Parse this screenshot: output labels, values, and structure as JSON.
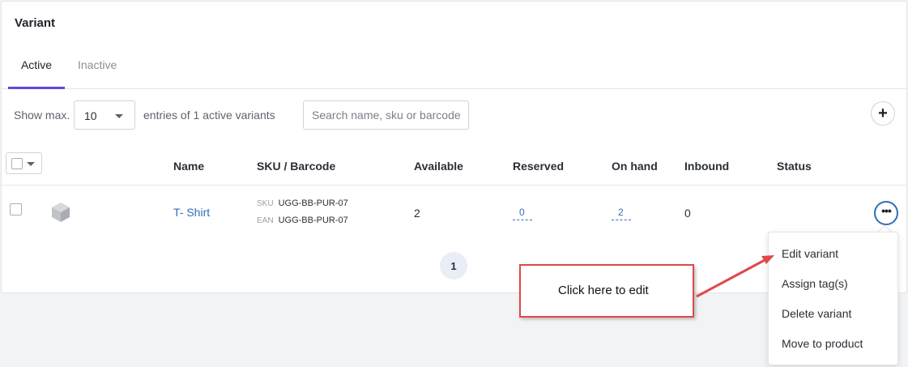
{
  "card": {
    "title": "Variant"
  },
  "tabs": [
    {
      "label": "Active",
      "active": true
    },
    {
      "label": "Inactive",
      "active": false
    }
  ],
  "toolbar": {
    "show_max_label": "Show max.",
    "entries_value": "10",
    "entries_suffix": "entries of 1 active variants",
    "search_placeholder": "Search name, sku or barcode",
    "add_icon": "plus-icon"
  },
  "table": {
    "columns": [
      "Name",
      "SKU / Barcode",
      "Available",
      "Reserved",
      "On hand",
      "Inbound",
      "Status"
    ],
    "rows": [
      {
        "name": "T- Shirt",
        "sku_tag": "SKU",
        "sku": "UGG-BB-PUR-07",
        "ean_tag": "EAN",
        "ean": "UGG-BB-PUR-07",
        "available": "2",
        "reserved": "0",
        "on_hand": "2",
        "inbound": "0",
        "status": ""
      }
    ]
  },
  "pagination": {
    "current": "1"
  },
  "menu": {
    "items": [
      "Edit variant",
      "Assign tag(s)",
      "Delete variant",
      "Move to product"
    ]
  },
  "callout": {
    "text": "Click here to edit"
  },
  "colors": {
    "accent": "#5b4bd6",
    "link": "#2f6fb4",
    "callout": "#e0484a"
  }
}
